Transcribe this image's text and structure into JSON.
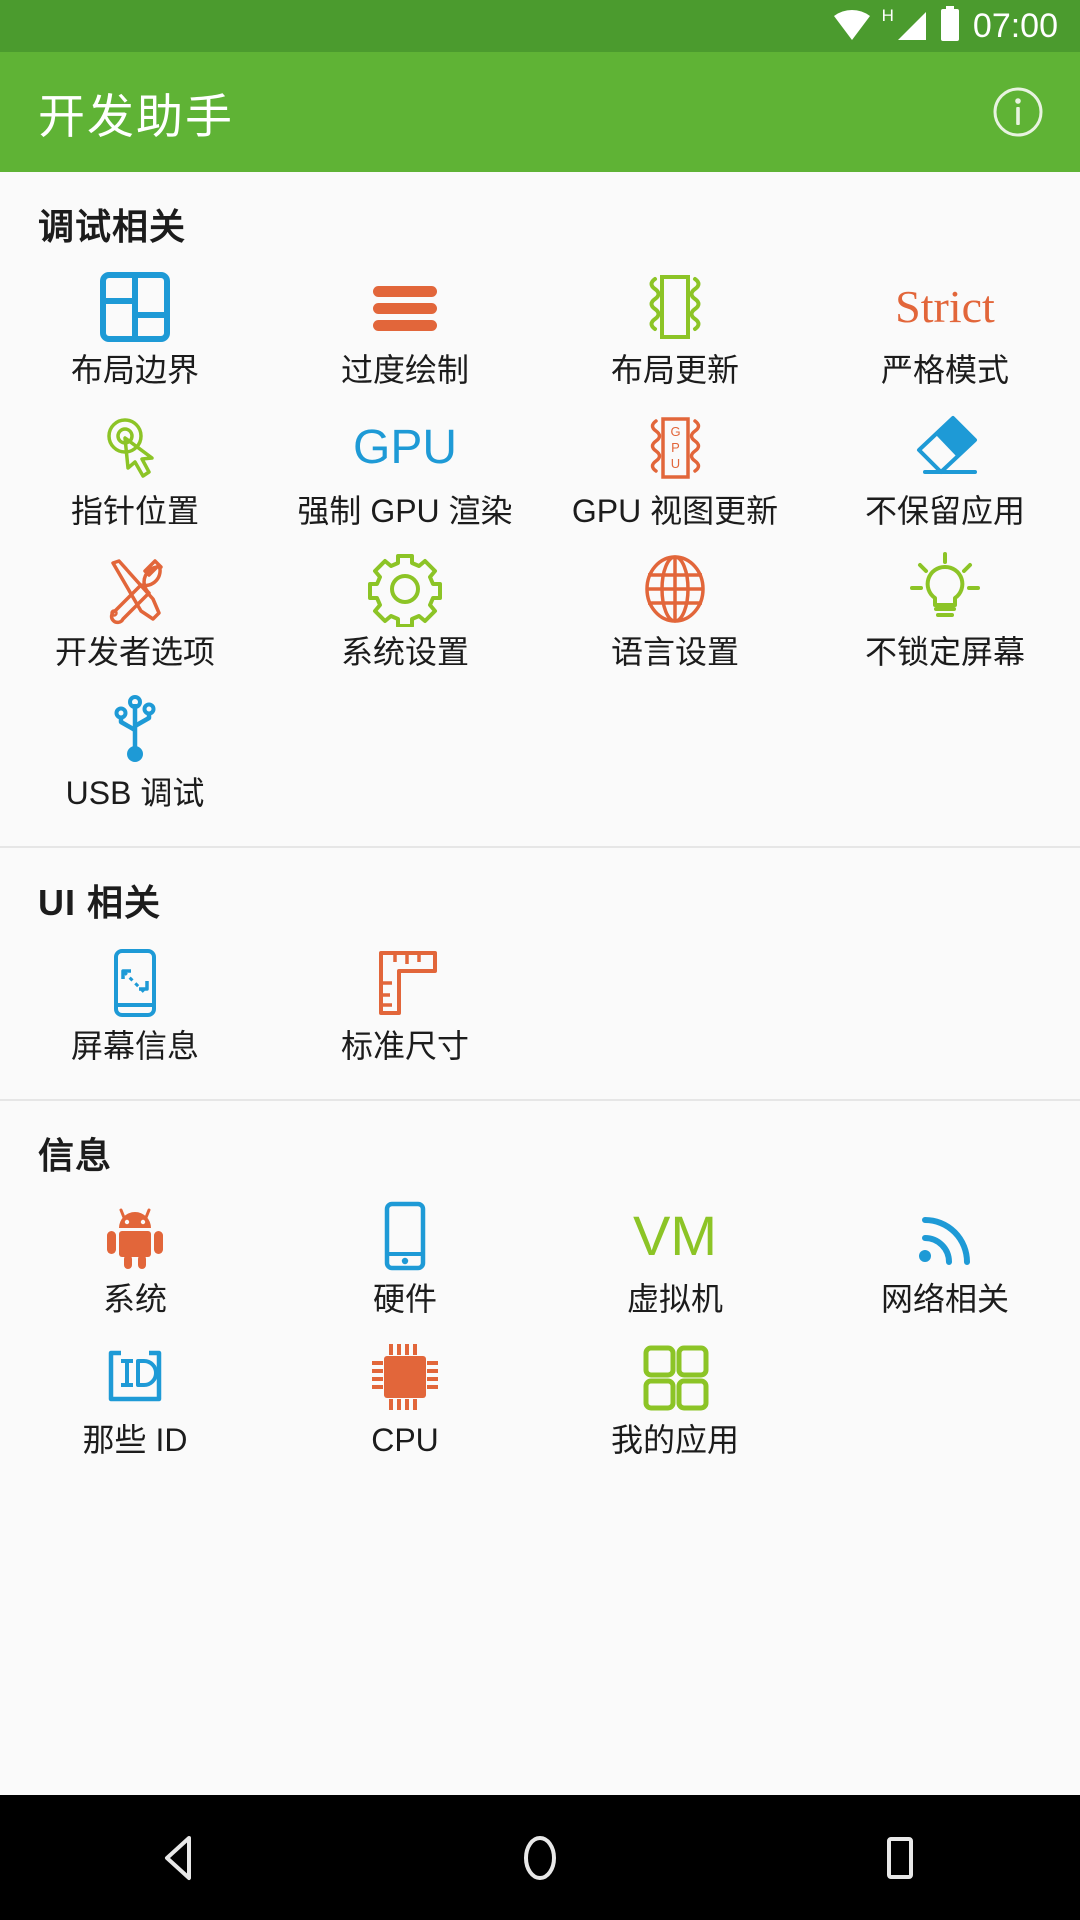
{
  "status_bar": {
    "time": "07:00",
    "network_label": "H",
    "icons": [
      "wifi-icon",
      "signal-icon",
      "battery-icon"
    ],
    "background": "#4b9b2e"
  },
  "app_bar": {
    "title": "开发助手",
    "info_icon": "info-icon",
    "background": "#5fb335"
  },
  "colors": {
    "blue": "#1e9ad6",
    "orange": "#e2663a",
    "green": "#8cc426",
    "text": "#1c1c1c",
    "page_bg": "#fafafa",
    "divider": "#e6e6e6"
  },
  "sections": [
    {
      "title": "调试相关",
      "items": [
        {
          "label": "布局边界",
          "icon": "layout-bounds-icon",
          "color": "#1e9ad6"
        },
        {
          "label": "过度绘制",
          "icon": "overdraw-icon",
          "color": "#e2663a"
        },
        {
          "label": "布局更新",
          "icon": "layout-update-icon",
          "color": "#8cc426"
        },
        {
          "label": "严格模式",
          "icon": "strict-text-icon",
          "color": "#e2663a",
          "text": "Strict"
        },
        {
          "label": "指针位置",
          "icon": "pointer-location-icon",
          "color": "#8cc426"
        },
        {
          "label": "强制 GPU 渲染",
          "icon": "gpu-text-icon",
          "color": "#1e9ad6",
          "text": "GPU"
        },
        {
          "label": "GPU 视图更新",
          "icon": "gpu-view-update-icon",
          "color": "#e2663a"
        },
        {
          "label": "不保留应用",
          "icon": "eraser-icon",
          "color": "#1e9ad6"
        },
        {
          "label": "开发者选项",
          "icon": "tools-icon",
          "color": "#e2663a"
        },
        {
          "label": "系统设置",
          "icon": "gear-icon",
          "color": "#8cc426"
        },
        {
          "label": "语言设置",
          "icon": "globe-icon",
          "color": "#e2663a"
        },
        {
          "label": "不锁定屏幕",
          "icon": "lightbulb-icon",
          "color": "#8cc426"
        },
        {
          "label": "USB 调试",
          "icon": "usb-icon",
          "color": "#1e9ad6"
        }
      ]
    },
    {
      "title": "UI 相关",
      "items": [
        {
          "label": "屏幕信息",
          "icon": "screen-info-icon",
          "color": "#1e9ad6"
        },
        {
          "label": "标准尺寸",
          "icon": "ruler-icon",
          "color": "#e2663a"
        }
      ]
    },
    {
      "title": "信息",
      "items": [
        {
          "label": "系统",
          "icon": "android-icon",
          "color": "#e2663a"
        },
        {
          "label": "硬件",
          "icon": "phone-icon",
          "color": "#1e9ad6"
        },
        {
          "label": "虚拟机",
          "icon": "vm-text-icon",
          "color": "#8cc426",
          "text": "VM"
        },
        {
          "label": "网络相关",
          "icon": "wifi-arc-icon",
          "color": "#1e9ad6"
        },
        {
          "label": "那些 ID",
          "icon": "id-icon",
          "color": "#1e9ad6"
        },
        {
          "label": "CPU",
          "icon": "cpu-chip-icon",
          "color": "#e2663a"
        },
        {
          "label": "我的应用",
          "icon": "apps-grid-icon",
          "color": "#8cc426"
        }
      ]
    }
  ],
  "nav_bar": {
    "back": "back-triangle-icon",
    "home": "home-circle-icon",
    "recents": "recents-square-icon",
    "background": "#000000"
  }
}
